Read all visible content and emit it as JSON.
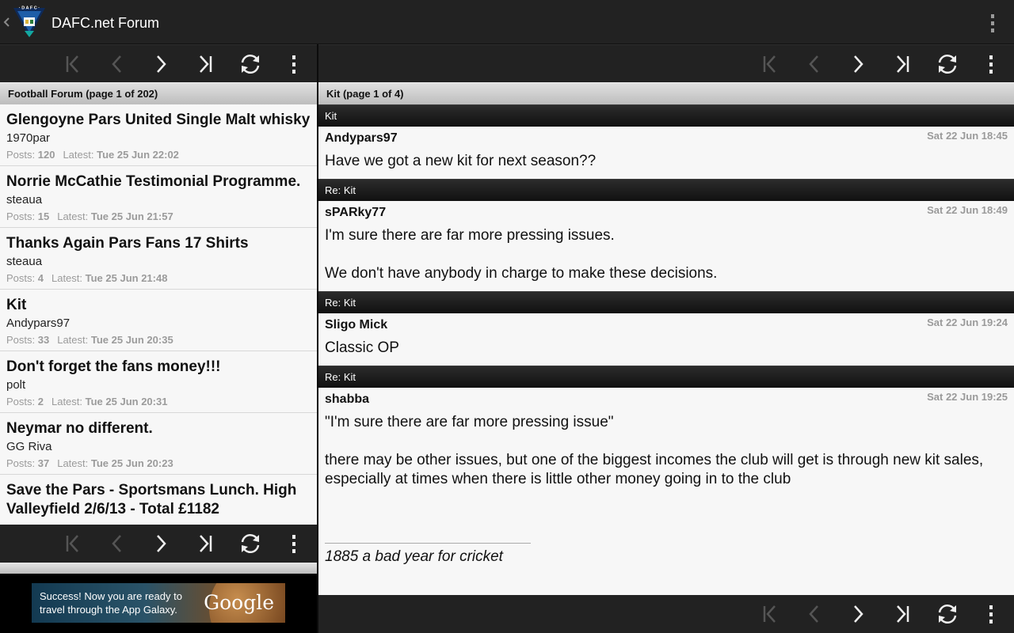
{
  "app": {
    "title": "DAFC.net Forum",
    "logo_text": "· D A F C ·"
  },
  "icons": {
    "first": "first-page-icon",
    "prev": "previous-page-icon",
    "next": "next-page-icon",
    "last": "last-page-icon",
    "refresh": "refresh-icon",
    "overflow": "overflow-menu-icon"
  },
  "colors": {
    "actionbar": "#222222",
    "header_light": "#d6d6d6",
    "header_dark": "#1e1e1e",
    "list_bg": "#f7f7f7",
    "meta_grey": "#9b9b9b"
  },
  "forum": {
    "header": "Football Forum (page 1 of 202)",
    "posts_label": "Posts:",
    "latest_label": "Latest:",
    "topics": [
      {
        "title": "Glengoyne Pars United Single Malt whisky",
        "author": "1970par",
        "posts": "120",
        "latest": "Tue 25 Jun 22:02"
      },
      {
        "title": "Norrie McCathie Testimonial Programme.",
        "author": "steaua",
        "posts": "15",
        "latest": "Tue 25 Jun 21:57"
      },
      {
        "title": "Thanks Again Pars Fans 17 Shirts",
        "author": "steaua",
        "posts": "4",
        "latest": "Tue 25 Jun 21:48"
      },
      {
        "title": "Kit",
        "author": "Andypars97",
        "posts": "33",
        "latest": "Tue 25 Jun 20:35"
      },
      {
        "title": "Don't forget the fans money!!!",
        "author": "polt",
        "posts": "2",
        "latest": "Tue 25 Jun 20:31"
      },
      {
        "title": "Neymar no different.",
        "author": "GG Riva",
        "posts": "37",
        "latest": "Tue 25 Jun 20:23"
      },
      {
        "title": "Save the Pars - Sportsmans Lunch. High Valleyfield 2/6/13 - Total £1182",
        "author": "",
        "posts": "",
        "latest": ""
      }
    ]
  },
  "thread": {
    "header": "Kit (page 1 of 4)",
    "posts": [
      {
        "subject": "Kit",
        "author": "Andypars97",
        "date": "Sat 22 Jun 18:45",
        "paragraphs": [
          "Have we got a new kit for next season??"
        ],
        "signature": ""
      },
      {
        "subject": "Re: Kit",
        "author": "sPARky77",
        "date": "Sat 22 Jun 18:49",
        "paragraphs": [
          "I'm sure there are far more pressing issues.",
          "We don't have anybody in charge to make these decisions."
        ],
        "signature": ""
      },
      {
        "subject": "Re: Kit",
        "author": "Sligo Mick",
        "date": "Sat 22 Jun 19:24",
        "paragraphs": [
          "Classic OP"
        ],
        "signature": ""
      },
      {
        "subject": "Re: Kit",
        "author": "shabba",
        "date": "Sat 22 Jun 19:25",
        "paragraphs": [
          "\"I'm sure there are far more pressing issue\"",
          "there may be other issues, but one of the biggest incomes the club will get is through new kit sales, especially at times when there is little other money going in to the club"
        ],
        "signature": "1885 a bad year for cricket"
      }
    ]
  },
  "ad": {
    "text": "Success! Now you are ready to travel through the App Galaxy.",
    "brand": "Google"
  }
}
